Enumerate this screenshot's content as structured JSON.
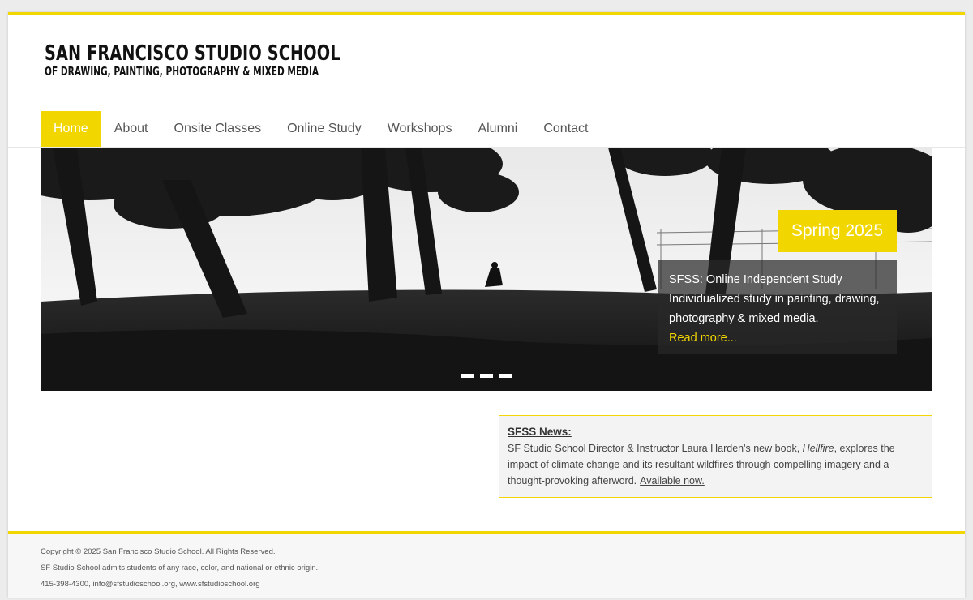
{
  "brand": {
    "line1": "SAN FRANCISCO STUDIO SCHOOL",
    "line2": "OF DRAWING, PAINTING, PHOTOGRAPHY & MIXED MEDIA"
  },
  "nav": {
    "items": [
      {
        "label": "Home",
        "active": true
      },
      {
        "label": "About"
      },
      {
        "label": "Onsite Classes"
      },
      {
        "label": "Online Study"
      },
      {
        "label": "Workshops"
      },
      {
        "label": "Alumni"
      },
      {
        "label": "Contact"
      }
    ]
  },
  "hero": {
    "badge": "Spring 2025",
    "caption_line1": "SFSS: Online Independent Study",
    "caption_line2": "Individualized study in painting, drawing, photography & mixed media.",
    "read_more": "Read more...",
    "slide_count": 3
  },
  "news": {
    "title": "SFSS News:",
    "text_before": "SF Studio School Director & Instructor Laura Harden's new book, ",
    "book_title": "Hellfire",
    "text_after": ", explores the impact of climate change and its resultant wildfires through compelling imagery and a thought-provoking afterword.",
    "link": "Available now."
  },
  "footer": {
    "copyright": "Copyright © 2025 San Francisco Studio School.  All Rights Reserved.",
    "admission": "SF Studio School admits students of any race, color, and national or ethnic origin.",
    "contact": "415-398-4300, info@sfstudioschool.org, www.sfstudioschool.org"
  },
  "colors": {
    "accent": "#f2d600",
    "text": "#333333",
    "footer_bg": "#f7f7f7"
  }
}
